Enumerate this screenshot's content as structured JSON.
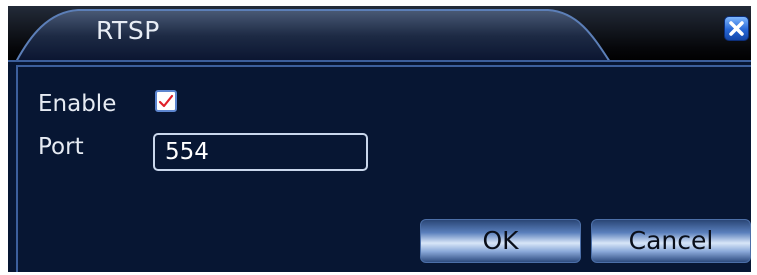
{
  "window": {
    "title": "RTSP",
    "close_icon": "close-icon"
  },
  "form": {
    "enable_label": "Enable",
    "enable_checked": true,
    "port_label": "Port",
    "port_value": "554"
  },
  "buttons": {
    "ok_label": "OK",
    "cancel_label": "Cancel"
  },
  "colors": {
    "background": "#071633",
    "accent": "#3c5f9c",
    "check_mark": "#e0202a"
  }
}
